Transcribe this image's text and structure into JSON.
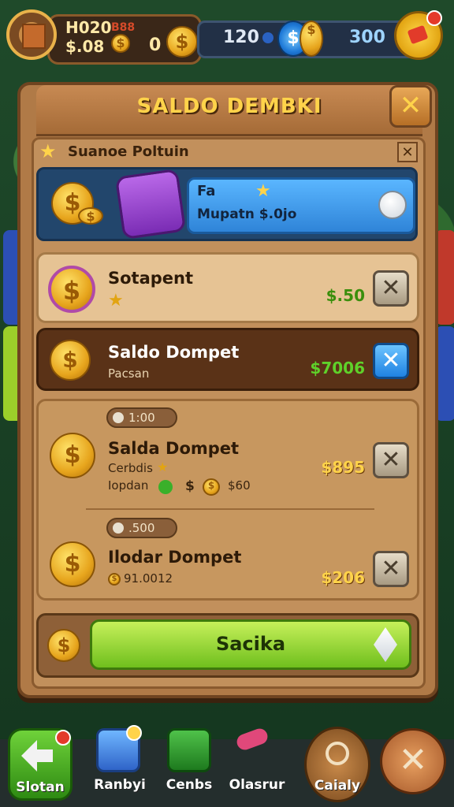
{
  "topbar": {
    "player_name": "H020",
    "tag": "B88",
    "balance": "$.08",
    "zero": "0",
    "resource_a": "120",
    "resource_b": "300"
  },
  "dialog": {
    "title": "SALDO DEMBKI",
    "subheader": "Suanoe Poltuin",
    "promo": {
      "title": "Fa",
      "subtitle": "Mupatn $.0jo"
    },
    "rows": [
      {
        "title": "Sotapent",
        "price": "$.50",
        "price_color": "#3a8e0c"
      },
      {
        "title": "Saldo Dompet",
        "sub": "Pacsan",
        "price": "$7006",
        "price_color": "#5fd12a"
      },
      {
        "pill": "1:00",
        "title": "Salda Dompet",
        "sub1": "Cerbdis",
        "sub2": "Iopdan",
        "sub2_value": "$60",
        "price": "$895",
        "price_color": "#ffd34a"
      },
      {
        "pill": ".500",
        "title": "Ilodar Dompet",
        "sub": "91.0012",
        "price": "$206",
        "price_color": "#ffd34a"
      }
    ],
    "action_button": "Sacika"
  },
  "bottom_nav": [
    {
      "label": "Slotan"
    },
    {
      "label": "Ranbyi"
    },
    {
      "label": "Cenbs"
    },
    {
      "label": "Olasrur"
    },
    {
      "label": "Caialy"
    }
  ]
}
